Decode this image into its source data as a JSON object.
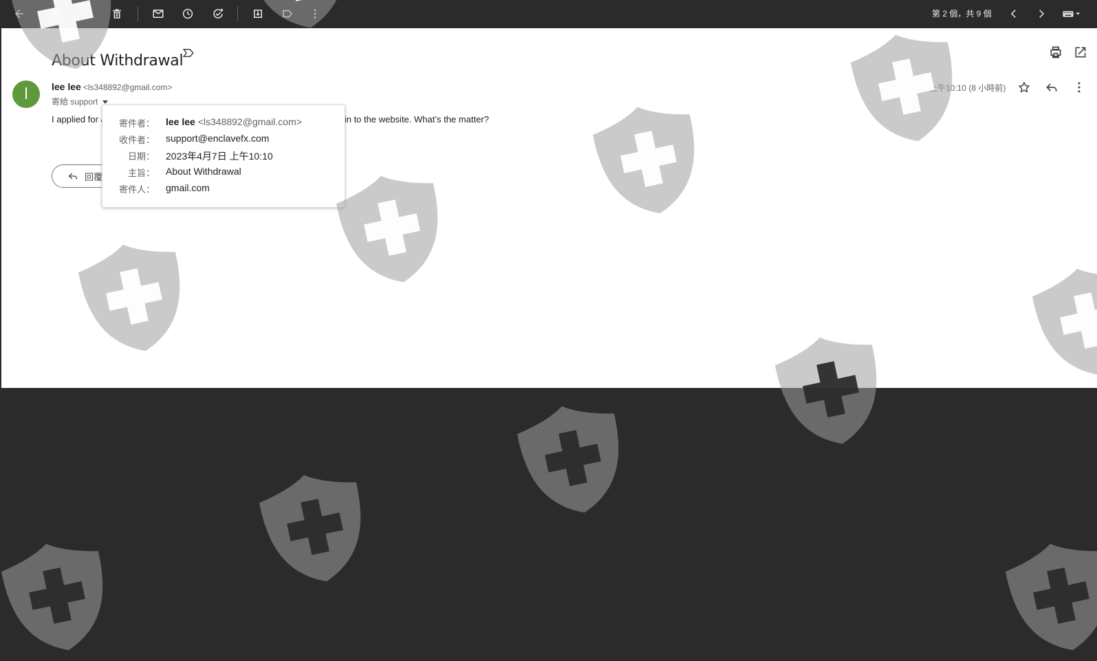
{
  "toolbar": {
    "icons": [
      "back-arrow-icon",
      "archive-icon",
      "report-spam-icon",
      "delete-icon",
      "mark-unread-icon",
      "snooze-icon",
      "add-task-icon",
      "move-to-icon",
      "label-icon",
      "more-vertical-icon"
    ],
    "pager": "第 2 個，共 9 個",
    "keyboard_icon": "keyboard-icon"
  },
  "message": {
    "subject": "About Withdrawal",
    "avatar_letter": "l",
    "avatar_color": "#5e9a3b",
    "sender_name": "lee lee",
    "sender_email": "<ls348892@gmail.com>",
    "to_line": "寄給 support",
    "timestamp": "上午10:10 (8 小時前)",
    "body_start": "I applied for a",
    "body_end": "g in to the website. What’s the matter?",
    "reply_label": "回覆"
  },
  "details": {
    "from_label": "寄件者：",
    "from_name": "lee lee",
    "from_email": "<ls348892@gmail.com>",
    "to_label": "收件者：",
    "to_value": "support@enclavefx.com",
    "date_label": "日期：",
    "date_value": "2023年4月7日 上午10:10",
    "subject_label": "主旨：",
    "subject_value": "About Withdrawal",
    "mailedby_label": "寄件人：",
    "mailedby_value": "gmail.com"
  },
  "colors": {
    "panel_bg": "#ffffff",
    "app_bg": "#2b2b2b",
    "watermark": "#9e9e9e"
  }
}
